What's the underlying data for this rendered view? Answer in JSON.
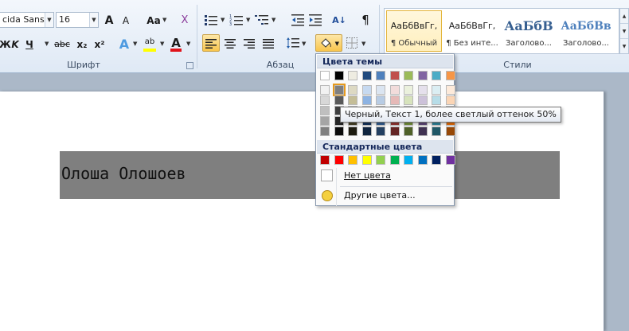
{
  "font": {
    "family_value": "cida Sans T",
    "size_value": "16",
    "group_label": "Шрифт",
    "buttons": [
      "A",
      "A",
      "Aa",
      "X",
      "Ж",
      "K",
      "Ч",
      "abc",
      "x₂",
      "x²",
      "A",
      "ab",
      "A"
    ]
  },
  "paragraph": {
    "group_label": "Абзац",
    "pilcrow": "¶",
    "sort": "A↓"
  },
  "styles": {
    "group_label": "Стили",
    "items": [
      {
        "preview": "АаБбВвГг,",
        "name": "¶ Обычный"
      },
      {
        "preview": "АаБбВвГг,",
        "name": "¶ Без инте..."
      },
      {
        "preview": "АаБбВ",
        "name": "Заголово..."
      },
      {
        "preview": "АаБбВв",
        "name": "Заголово..."
      }
    ]
  },
  "document": {
    "text": "Олоша Олошоев"
  },
  "shading_menu": {
    "theme_header": "Цвета темы",
    "standard_header": "Стандартные цвета",
    "no_color": "Нет цвета",
    "more_colors": "Другие цвета...",
    "tooltip": "Черный, Текст 1, более светлый оттенок 50%",
    "theme_colors": [
      [
        "#ffffff",
        "#000000",
        "#eeece1",
        "#1f497d",
        "#4f81bd",
        "#c0504d",
        "#9bbb59",
        "#8064a2",
        "#4bacc6",
        "#f79646"
      ],
      [
        "#f2f2f2",
        "#7f7f7f",
        "#ddd9c3",
        "#c6d9f0",
        "#dbe5f1",
        "#f2dcdb",
        "#ebf1dd",
        "#e5e0ec",
        "#dbeef3",
        "#fdeada"
      ],
      [
        "#d8d8d8",
        "#595959",
        "#c4bd97",
        "#8db3e2",
        "#b8cce4",
        "#e5b9b7",
        "#d7e3bc",
        "#ccc1d9",
        "#b7dde8",
        "#fbd5b5"
      ],
      [
        "#bfbfbf",
        "#3f3f3f",
        "#938953",
        "#548dd4",
        "#95b3d7",
        "#d99694",
        "#c3d69b",
        "#b2a2c7",
        "#92cddc",
        "#fac08f"
      ],
      [
        "#a5a5a5",
        "#262626",
        "#494429",
        "#17365d",
        "#366092",
        "#953734",
        "#76923c",
        "#5f497a",
        "#31859b",
        "#e36c09"
      ],
      [
        "#7f7f7f",
        "#0c0c0c",
        "#1d1b10",
        "#0f243e",
        "#244061",
        "#632423",
        "#4f6128",
        "#3f3151",
        "#205867",
        "#974806"
      ]
    ],
    "standard_colors": [
      "#c00000",
      "#ff0000",
      "#ffc000",
      "#ffff00",
      "#92d050",
      "#00b050",
      "#00b0f0",
      "#0070c0",
      "#002060",
      "#7030a0"
    ],
    "hovered": {
      "row": 1,
      "col": 1
    }
  }
}
